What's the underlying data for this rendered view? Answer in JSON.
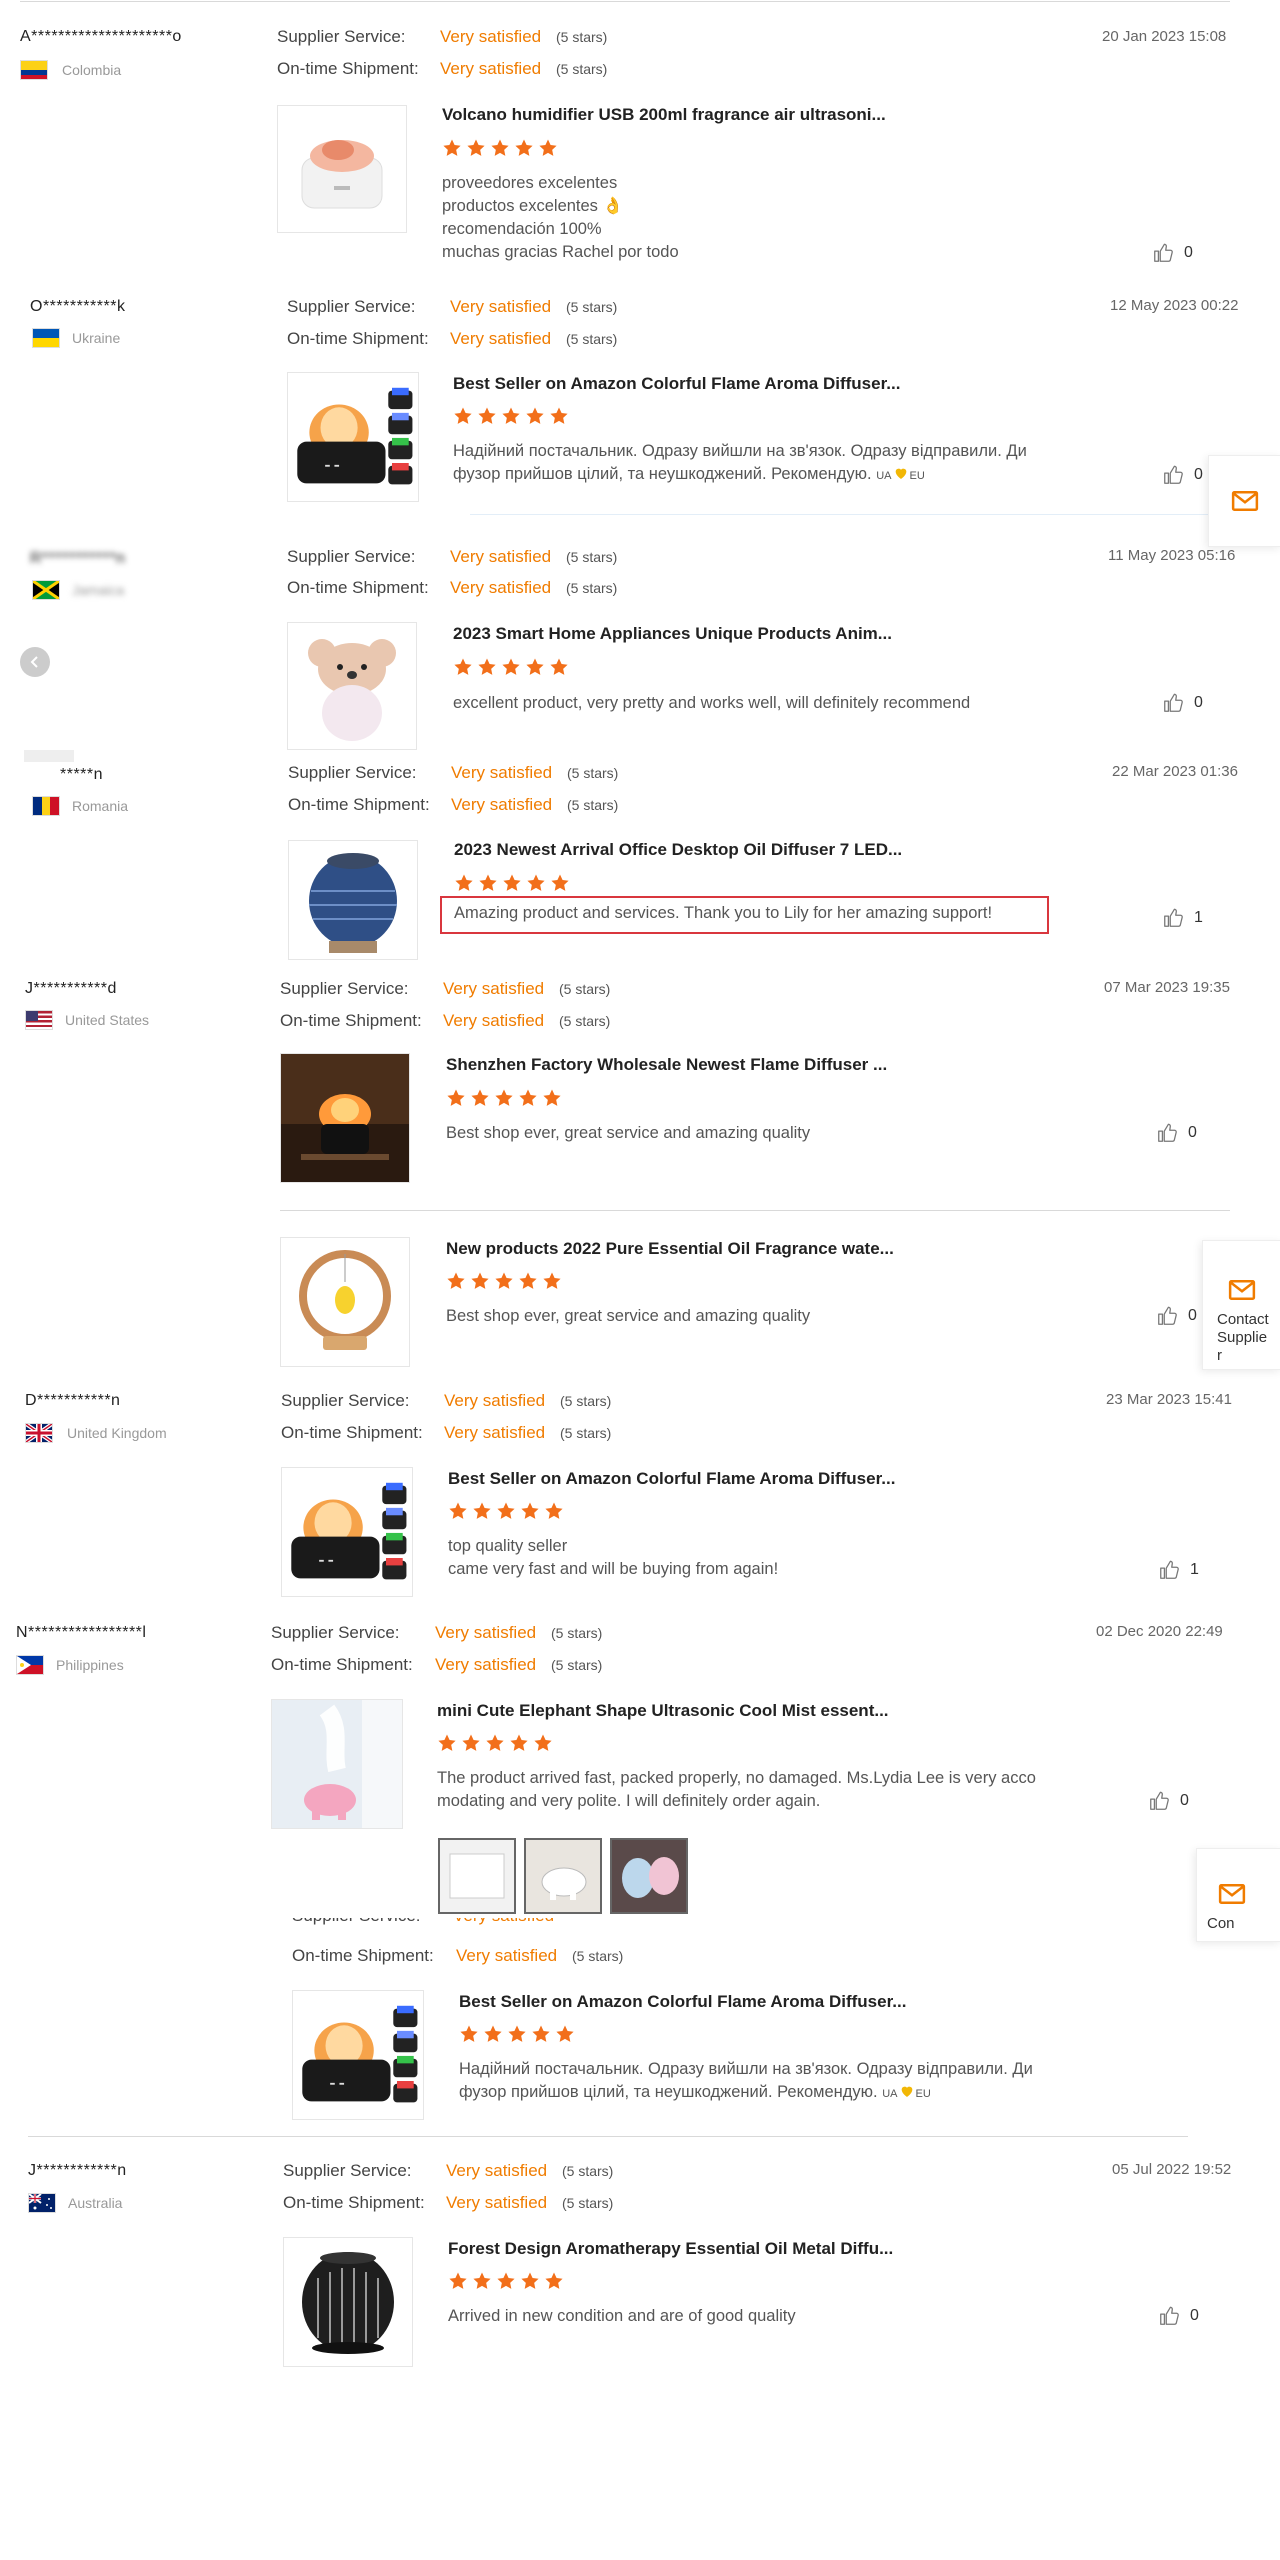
{
  "labels": {
    "supplier_service": "Supplier Service:",
    "on_time_shipment": "On-time Shipment:",
    "very_satisfied": "Very satisfied",
    "five_stars": "(5 stars)"
  },
  "colors": {
    "accent": "#f07c00",
    "star": "#f26f1a",
    "highlight_border": "#d9363e"
  },
  "reviews": [
    {
      "name": "A*********************o",
      "country": "Colombia",
      "date": "20 Jan 2023 15:08",
      "product": "Volcano humidifier USB 200ml fragrance air ultrasoni...",
      "comment_lines": [
        "proveedores excelentes",
        "productos excelentes 👌",
        "recomendación 100%",
        "muchas gracias Rachel por todo"
      ],
      "likes": "0"
    },
    {
      "name": "O***********k",
      "country": "Ukraine",
      "date": "12 May 2023 00:22",
      "product": "Best Seller on Amazon Colorful Flame Aroma Diffuser...",
      "comment_lines": [
        "Надійний постачальник.  Одразу вийшли на зв'язок.  Одразу відправили. Ди",
        "фузор прийшов цілий, та неушкоджений.  Рекомендую."
      ],
      "badge_left": "UA",
      "badge_right": "EU",
      "likes": "0"
    },
    {
      "name": "R***********n",
      "country": "Jamaica",
      "date": "11 May 2023 05:16",
      "product": "2023 Smart Home Appliances Unique Products Anim...",
      "comment_lines": [
        "excellent product, very pretty and works well, will definitely recommend"
      ],
      "likes": "0"
    },
    {
      "name": "*****n",
      "country": "Romania",
      "date": "22 Mar 2023 01:36",
      "product": "2023 Newest Arrival Office Desktop Oil Diffuser 7 LED...",
      "comment_lines": [
        "Amazing product and services. Thank you to Lily for her amazing support!"
      ],
      "likes": "1"
    },
    {
      "name": "J***********d",
      "country": "United States",
      "date": "07 Mar 2023 19:35",
      "product": "Shenzhen Factory Wholesale Newest Flame Diffuser ...",
      "comment_lines": [
        "Best shop ever, great service and amazing quality"
      ],
      "likes": "0",
      "product2": "New products 2022 Pure Essential Oil Fragrance wate...",
      "comment2": "Best shop ever, great service and amazing quality",
      "likes2": "0"
    },
    {
      "name": "D***********n",
      "country": "United Kingdom",
      "date": "23 Mar 2023 15:41",
      "product": "Best Seller on Amazon Colorful Flame Aroma Diffuser...",
      "comment_lines": [
        "top quality seller",
        "came very fast and will be buying from again!"
      ],
      "likes": "1"
    },
    {
      "name": "N*****************l",
      "country": "Philippines",
      "date": "02 Dec 2020 22:49",
      "product": "mini Cute Elephant Shape Ultrasonic Cool Mist essent...",
      "comment_lines": [
        "The product arrived fast, packed properly, no damaged. Ms.Lydia Lee is very acco",
        "modating and very polite. I will definitely order again."
      ],
      "likes": "0"
    },
    {
      "product": "Best Seller on Amazon Colorful Flame Aroma Diffuser...",
      "comment_lines": [
        "Надійний постачальник.  Одразу вийшли на зв'язок.  Одразу відправили. Ди",
        "фузор прийшов цілий, та неушкоджений.  Рекомендую."
      ],
      "badge_left": "UA",
      "badge_right": "EU"
    },
    {
      "name": "J************n",
      "country": "Australia",
      "date": "05 Jul 2022 19:52",
      "product": "Forest Design Aromatherapy Essential Oil Metal Diffu...",
      "comment_lines": [
        "Arrived in new condition and are of good quality"
      ],
      "likes": "0"
    }
  ],
  "side": {
    "contact_label": "Contact Supplier",
    "contact_lines": [
      "Contact",
      "Supplie",
      "r"
    ],
    "partial_label": "Con"
  }
}
